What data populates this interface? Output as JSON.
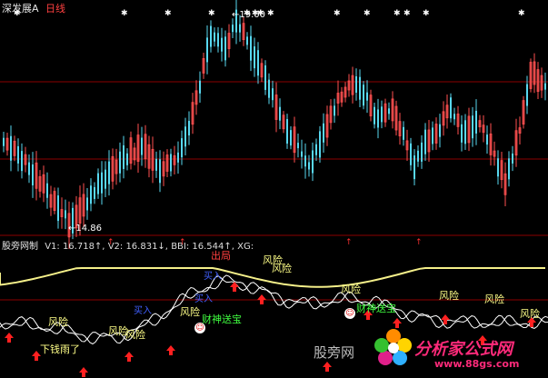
{
  "main_panel": {
    "title": "深发展A",
    "period": "日线",
    "high_marker": "19.00",
    "low_marker": "14.86",
    "colors": {
      "up": "#ff5050",
      "down": "#58d8f0",
      "bg": "#000000",
      "grid": "#8b0000"
    }
  },
  "indicator_panel": {
    "name": "股旁网制",
    "values": [
      {
        "key": "V1",
        "text": "V1: 16.718↑,",
        "color": "#dddddd"
      },
      {
        "key": "V2",
        "text": "V2: 16.831↓,",
        "color": "#dddddd"
      },
      {
        "key": "BBI",
        "text": "BBI: 16.544↑,",
        "color": "#dddddd"
      },
      {
        "key": "XG",
        "text": "XG:",
        "color": "#dddddd"
      }
    ],
    "signal_label": "出局",
    "annotations": [
      {
        "id": "risk-1",
        "text": "风险",
        "color": "#ffff88"
      },
      {
        "id": "risk-2",
        "text": "风险",
        "color": "#ffff88"
      },
      {
        "id": "risk-3",
        "text": "风险",
        "color": "#ffff88"
      },
      {
        "id": "risk-4",
        "text": "风险",
        "color": "#ffff88"
      },
      {
        "id": "risk-5",
        "text": "风险",
        "color": "#ffff88"
      },
      {
        "id": "risk-6",
        "text": "风险",
        "color": "#ffff88"
      },
      {
        "id": "risk-7",
        "text": "风险",
        "color": "#ffff88"
      },
      {
        "id": "risk-8",
        "text": "风险",
        "color": "#ffff88"
      },
      {
        "id": "risk-9",
        "text": "风险",
        "color": "#ffff88"
      },
      {
        "id": "risk-10",
        "text": "风险",
        "color": "#ffff88"
      },
      {
        "id": "money-down",
        "text": "下钱雨了",
        "color": "#ffff88"
      },
      {
        "id": "gift-1",
        "text": "财神送宝",
        "color": "#40ff40"
      },
      {
        "id": "gift-2",
        "text": "财神送宝",
        "color": "#40ff40"
      },
      {
        "id": "buy-1",
        "text": "买入",
        "color": "#4060ff"
      },
      {
        "id": "buy-2",
        "text": "买入",
        "color": "#4060ff"
      },
      {
        "id": "buy-3",
        "text": "买入",
        "color": "#4060ff"
      }
    ]
  },
  "watermark": {
    "site_name": "股旁网",
    "brand": "分析家公式网",
    "url": "www.88gs.com"
  }
}
